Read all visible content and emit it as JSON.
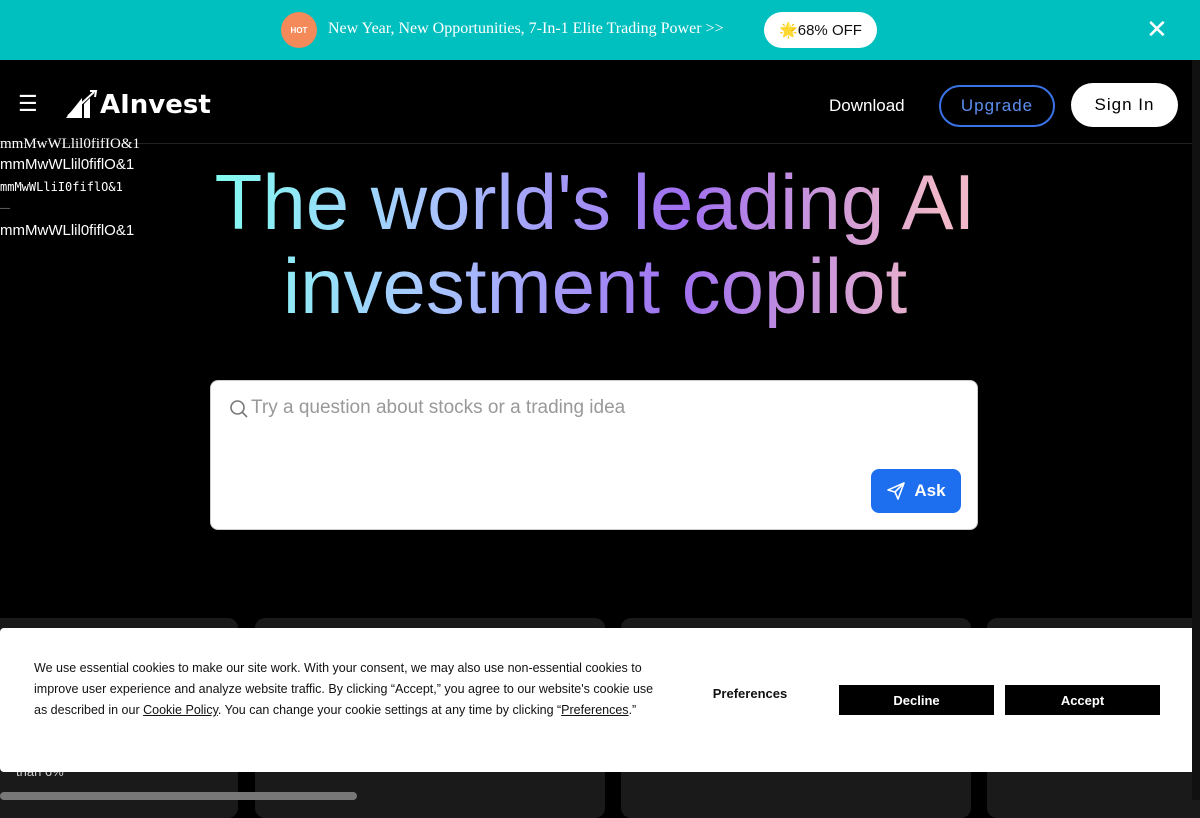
{
  "promo": {
    "badge": "HOT",
    "text": "New Year, New Opportunities, 7-In-1 Elite Trading Power >>",
    "offer_icon": "star-icon",
    "offer": "68% OFF",
    "close_icon": "close-icon"
  },
  "nav": {
    "menu_icon": "hamburger-icon",
    "logo": "AInvest",
    "download": "Download",
    "upgrade": "Upgrade",
    "signin": "Sign In"
  },
  "font_test": [
    "mmMwWLlil0fifIO&1",
    "mmMwWLlil0fiflO&1",
    "mmMwWLliI0fiflO&1",
    "—",
    "mmMwWLlil0fiflO&1"
  ],
  "hero": {
    "line1": "The world's leading AI",
    "line2": "investment copilot"
  },
  "search": {
    "placeholder": "Try a question about stocks or a trading idea",
    "value": "",
    "ask": "Ask"
  },
  "cookie": {
    "text1": "We use essential cookies to make our site work. With your consent, we may also use non-essential cookies to improve user experience and analyze website traffic. By clicking “Accept,” you agree to our website's cookie use as described in our ",
    "policy": "Cookie Policy",
    "text2": ". You can change your cookie settings at any time by clicking “",
    "prefs_link": "Preferences",
    "text3": ".”",
    "preferences": "Preferences",
    "decline": "Decline",
    "accept": "Accept"
  },
  "below_text": "than 6%",
  "colors": {
    "promo_bg": "#00bfbf",
    "accent": "#1e6ff0",
    "upgrade": "#3a73e8"
  }
}
